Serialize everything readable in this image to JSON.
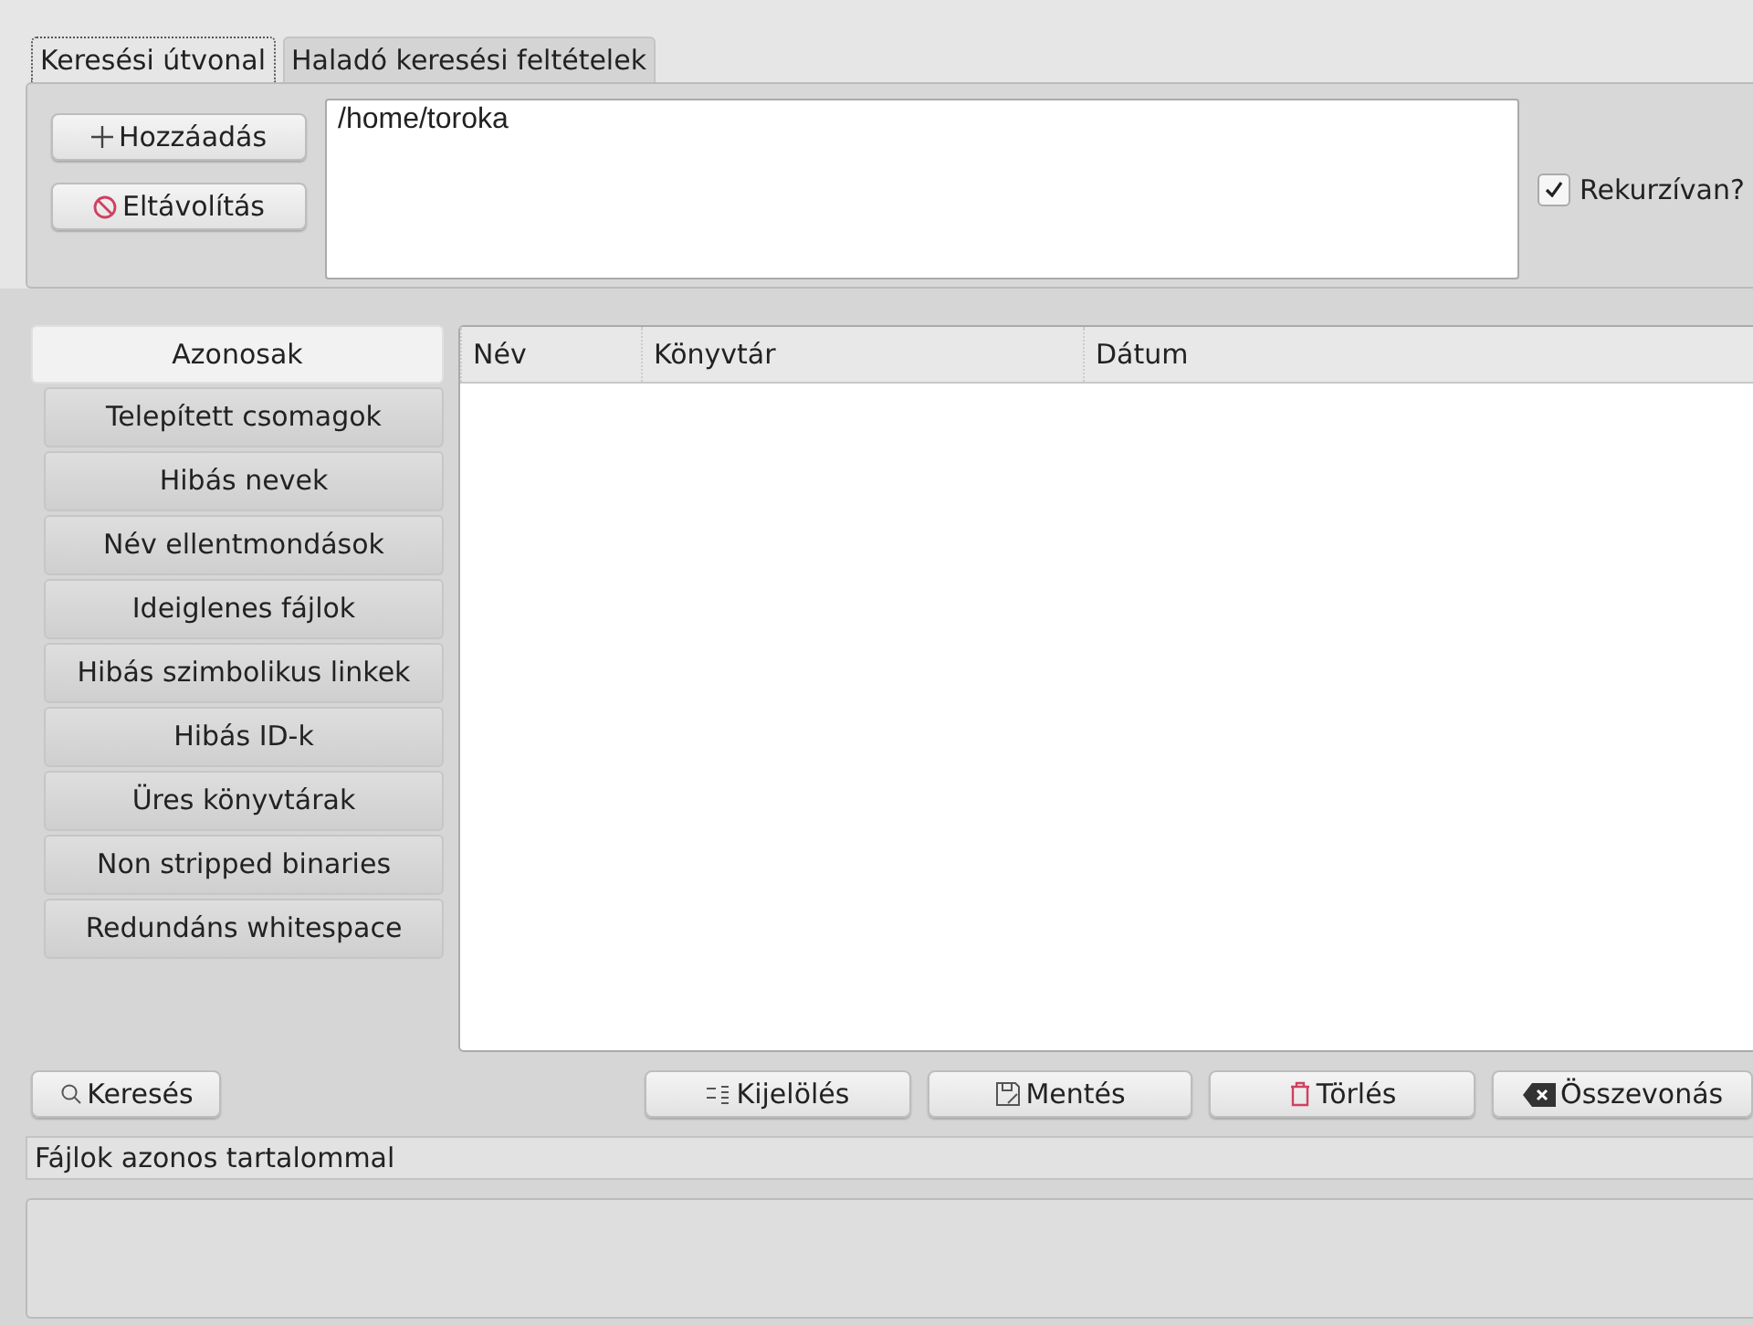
{
  "tabs": [
    {
      "label": "Keresési útvonal",
      "selected": true
    },
    {
      "label": "Haladó keresési feltételek",
      "selected": false
    }
  ],
  "path_buttons": [
    {
      "kind": "add",
      "label": "Hozzáadás"
    },
    {
      "kind": "remove",
      "label": "Eltávolítás"
    }
  ],
  "paths": [
    "/home/toroka"
  ],
  "recursive": {
    "label": "Rekurzívan?",
    "checked": true
  },
  "categories": [
    {
      "label": "Azonosak",
      "selected": true
    },
    {
      "label": "Telepített csomagok",
      "selected": false
    },
    {
      "label": "Hibás nevek",
      "selected": false
    },
    {
      "label": "Név ellentmondások",
      "selected": false
    },
    {
      "label": "Ideiglenes fájlok",
      "selected": false
    },
    {
      "label": "Hibás szimbolikus linkek",
      "selected": false
    },
    {
      "label": "Hibás ID-k",
      "selected": false
    },
    {
      "label": "Üres könyvtárak",
      "selected": false
    },
    {
      "label": "Non stripped binaries",
      "selected": false
    },
    {
      "label": "Redundáns whitespace",
      "selected": false
    }
  ],
  "table": {
    "columns": [
      "Név",
      "Könyvtár",
      "Dátum"
    ]
  },
  "search_button": {
    "label": "Keresés"
  },
  "action_buttons": [
    {
      "kind": "select",
      "label": "Kijelölés"
    },
    {
      "kind": "save",
      "label": "Mentés"
    },
    {
      "kind": "delete",
      "label": "Törlés"
    },
    {
      "kind": "merge",
      "label": "Összevonás"
    }
  ],
  "status_bar": "Fájlok azonos tartalommal"
}
